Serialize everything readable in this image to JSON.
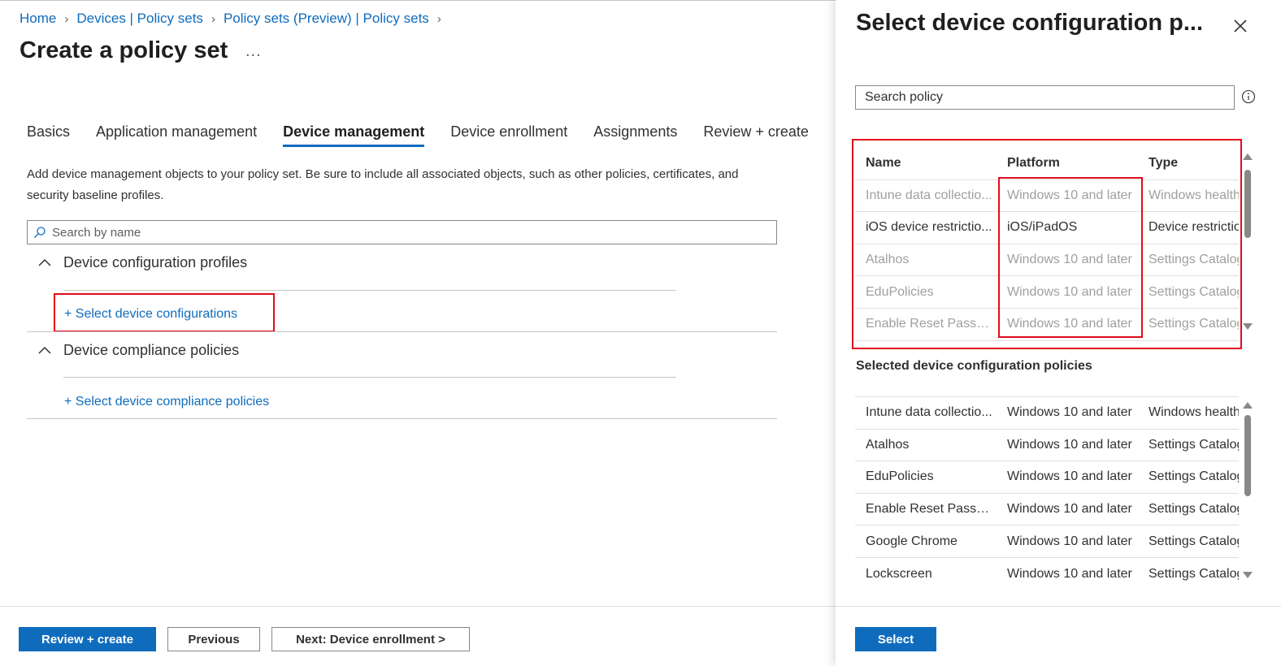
{
  "breadcrumb": [
    {
      "label": "Home"
    },
    {
      "label": "Devices | Policy sets"
    },
    {
      "label": "Policy sets (Preview) | Policy sets"
    }
  ],
  "page": {
    "title": "Create a policy set",
    "more": "..."
  },
  "tabs": [
    {
      "label": "Basics"
    },
    {
      "label": "Application management"
    },
    {
      "label": "Device management",
      "active": true
    },
    {
      "label": "Device enrollment"
    },
    {
      "label": "Assignments"
    },
    {
      "label": "Review + create"
    }
  ],
  "description": "Add device management objects to your policy set. Be sure to include all associated objects, such as other policies, certificates, and security baseline profiles.",
  "search": {
    "placeholder": "Search by name",
    "icon": "search-icon"
  },
  "sections": {
    "config": {
      "title": "Device configuration profiles",
      "link": "+ Select device configurations"
    },
    "compliance": {
      "title": "Device compliance policies",
      "link": "+ Select device compliance policies"
    }
  },
  "footer": {
    "review": "Review + create",
    "previous": "Previous",
    "next": "Next: Device enrollment >"
  },
  "blade": {
    "title": "Select device configuration p...",
    "search_placeholder": "Search policy",
    "columns": {
      "name": "Name",
      "platform": "Platform",
      "type": "Type"
    },
    "available": [
      {
        "name": "Intune data collectio...",
        "platform": "Windows 10 and later",
        "type": "Windows health",
        "dim": true
      },
      {
        "name": "iOS device restrictio...",
        "platform": "iOS/iPadOS",
        "type": "Device restrictions",
        "dim": false
      },
      {
        "name": "Atalhos",
        "platform": "Windows 10 and later",
        "type": "Settings Catalog",
        "dim": true
      },
      {
        "name": "EduPolicies",
        "platform": "Windows 10 and later",
        "type": "Settings Catalog",
        "dim": true
      },
      {
        "name": "Enable Reset Passwo...",
        "platform": "Windows 10 and later",
        "type": "Settings Catalog",
        "dim": true
      }
    ],
    "selected_heading": "Selected device configuration policies",
    "selected": [
      {
        "name": "Intune data collectio...",
        "platform": "Windows 10 and later",
        "type": "Windows health"
      },
      {
        "name": "Atalhos",
        "platform": "Windows 10 and later",
        "type": "Settings Catalog"
      },
      {
        "name": "EduPolicies",
        "platform": "Windows 10 and later",
        "type": "Settings Catalog"
      },
      {
        "name": "Enable Reset Passwo...",
        "platform": "Windows 10 and later",
        "type": "Settings Catalog"
      },
      {
        "name": "Google Chrome",
        "platform": "Windows 10 and later",
        "type": "Settings Catalog"
      },
      {
        "name": "Lockscreen",
        "platform": "Windows 10 and later",
        "type": "Settings Catalog"
      }
    ],
    "select_button": "Select"
  },
  "colors": {
    "accent": "#0f6cbd",
    "highlight": "#e00b1c",
    "dim_text": "#a19f9d"
  }
}
